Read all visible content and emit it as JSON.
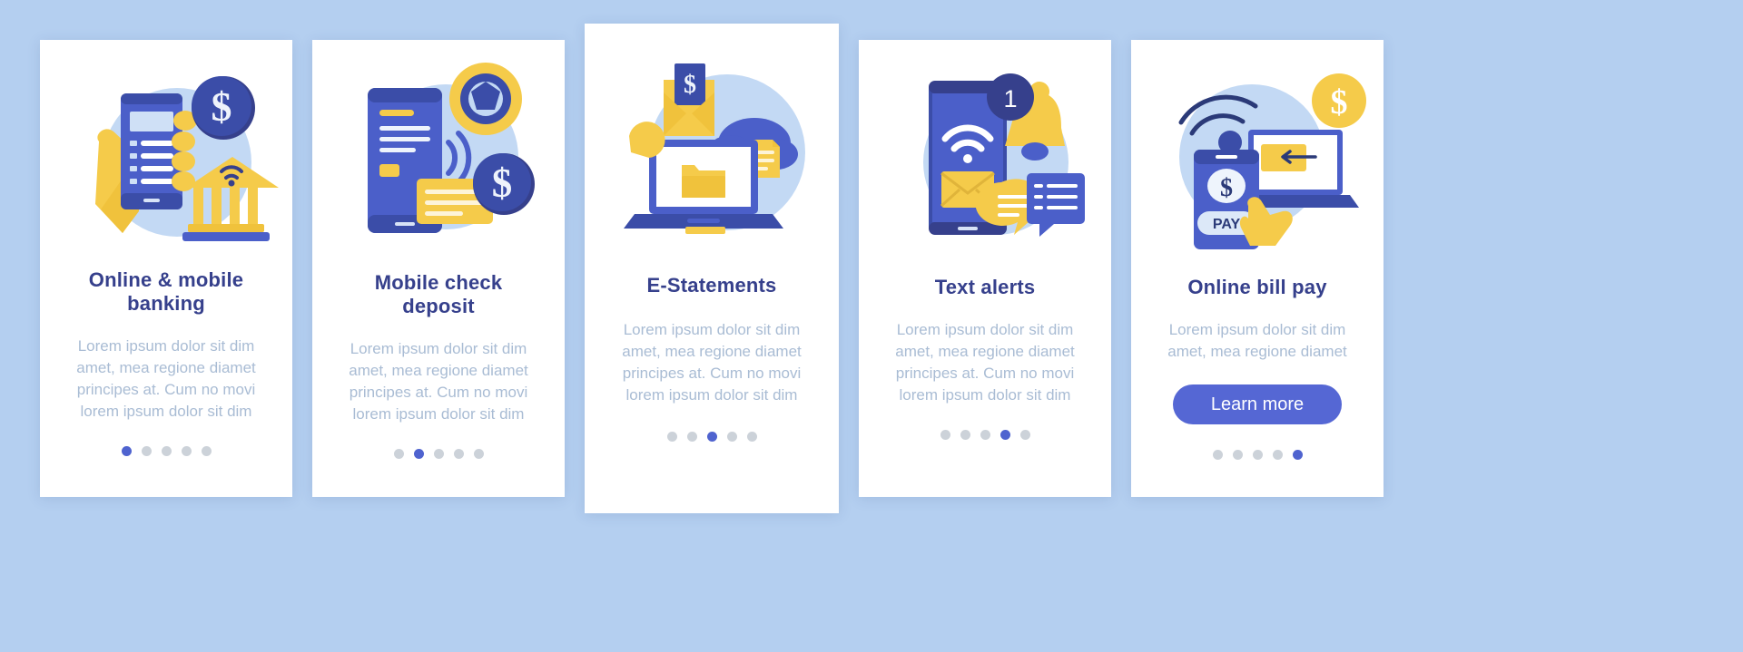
{
  "page": {
    "background_color": "#b4cff0",
    "card_background": "#ffffff",
    "title_color": "#36408c",
    "body_color": "#a9bcd4",
    "accent_color": "#5567d4",
    "dot_inactive_color": "#ccd2d9",
    "yellow": "#f5cb4a",
    "blue_light": "#b9d2f0"
  },
  "cards": [
    {
      "title": "Online & mobile banking",
      "body": "Lorem ipsum dolor sit dim amet, mea regione diamet principes at. Cum no movi lorem ipsum dolor sit dim",
      "icon": "phone-hand-bank-dollar-illustration",
      "dots": {
        "count": 5,
        "active_index": 0
      },
      "has_button": false
    },
    {
      "title": "Mobile  check deposit",
      "body": "Lorem ipsum dolor sit dim amet, mea regione diamet principes at. Cum no movi lorem ipsum dolor sit dim",
      "icon": "phone-camera-dollar-illustration",
      "dots": {
        "count": 5,
        "active_index": 1
      },
      "has_button": false
    },
    {
      "title": "E-Statements",
      "body": "Lorem ipsum dolor sit dim amet, mea regione diamet principes at. Cum no movi lorem ipsum dolor sit dim",
      "icon": "laptop-envelope-cloud-illustration",
      "dots": {
        "count": 5,
        "active_index": 2
      },
      "has_button": false
    },
    {
      "title": "Text alerts",
      "body": "Lorem ipsum dolor sit dim amet, mea regione diamet principes at. Cum no movi lorem ipsum dolor sit dim",
      "icon": "phone-bell-notification-illustration",
      "badge_count": "1",
      "dots": {
        "count": 5,
        "active_index": 3
      },
      "has_button": false
    },
    {
      "title": "Online bill pay",
      "body": "Lorem ipsum dolor sit dim amet, mea regione diamet",
      "icon": "phone-pay-laptop-dollar-illustration",
      "pay_label": "PAY",
      "dots": {
        "count": 5,
        "active_index": 4
      },
      "has_button": true,
      "button_label": "Learn more"
    }
  ]
}
